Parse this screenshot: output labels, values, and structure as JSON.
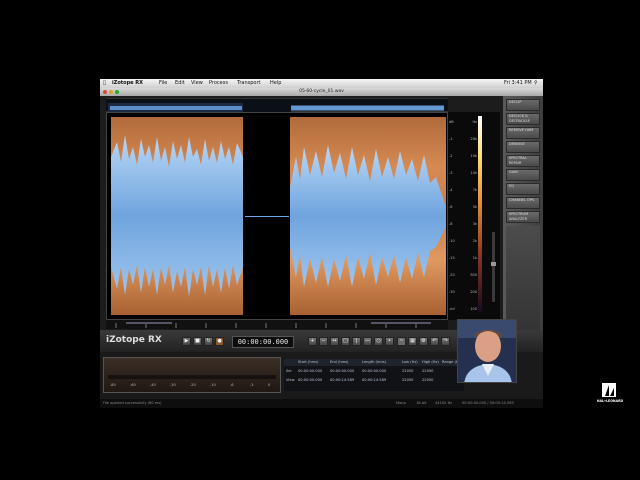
{
  "menubar": {
    "app": "iZotope RX",
    "items": [
      "File",
      "Edit",
      "View",
      "Process",
      "Transport",
      "Help"
    ],
    "clock": "Fri 3:41 PM"
  },
  "window": {
    "title": "05-60-cycle_01.wav"
  },
  "right_panel": {
    "modules": [
      "DECLIP",
      "DECLICK & DECRACKLE",
      "REMOVE HUM",
      "DENOISE",
      "SPECTRAL REPAIR",
      "GAIN",
      "EQ",
      "CHANNEL OPS",
      "SPECTRUM ANALYZER"
    ]
  },
  "transport": {
    "logo": "iZotope RX",
    "timecode": "00:00:00.000",
    "buttons": [
      "play",
      "stop",
      "loop",
      "record"
    ]
  },
  "selection_table": {
    "headers": [
      "Start (hms)",
      "End (hms)",
      "Length (hms)",
      "Low (Hz)",
      "High (Hz)",
      "Range (Hz)"
    ],
    "rows": [
      [
        "Sel",
        "00:00:00.000",
        "00:00:00.000",
        "00:00:00.000",
        "22050",
        "22050"
      ],
      [
        "View",
        "00:00:00.000",
        "00:00:14.589",
        "00:00:14.589",
        "22050",
        "22050"
      ]
    ]
  },
  "status": {
    "message": "File opened successfully (60 ms)",
    "right": [
      "Mono",
      "16-bit",
      "44100 Hz",
      "00:00:00.000 / 00:00:14.589"
    ]
  },
  "meter_ticks": [
    "-80",
    "-60",
    "-40",
    "-30",
    "-20",
    "-10",
    "-6",
    "-3",
    "0"
  ],
  "scale_labels": [
    "dB",
    "-1",
    "-2",
    "-3",
    "-4",
    "-6",
    "-8",
    "-10",
    "-15",
    "-20",
    "-30",
    "-inf"
  ],
  "hz_labels": [
    "Hz",
    "20k",
    "15k",
    "10k",
    "7k",
    "5k",
    "3k",
    "2k",
    "1k",
    "500",
    "200",
    "100"
  ],
  "colors": {
    "waveform": "#7fb8f0",
    "spectrogram": "#c97a45",
    "background": "#000000"
  },
  "watermark": "HAL•LEONARD"
}
